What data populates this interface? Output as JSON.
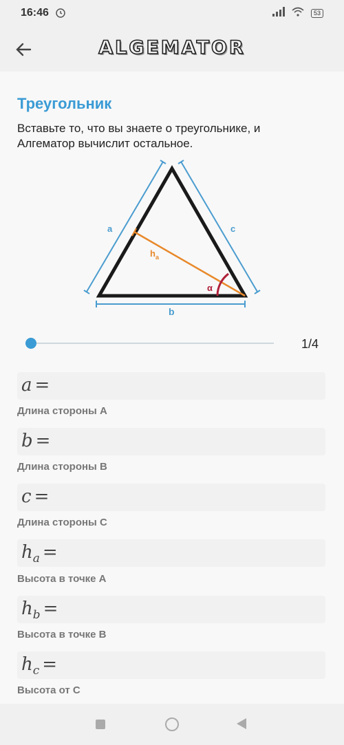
{
  "status_bar": {
    "time": "16:46",
    "battery": "53"
  },
  "app": {
    "logo": "ALGEMATOR"
  },
  "page": {
    "title": "Треугольник",
    "description": "Вставьте то, что вы знаете о треугольнике, и Алгематор вычислит остальное."
  },
  "diagram": {
    "side_a": "a",
    "side_b": "b",
    "side_c": "c",
    "height": "h",
    "height_sub": "a",
    "angle": "α"
  },
  "slider": {
    "label": "1/4",
    "progress": 0.0
  },
  "fields": [
    {
      "symbol": "a",
      "sub": "",
      "eq": "=",
      "value": "",
      "caption": "Длина стороны A"
    },
    {
      "symbol": "b",
      "sub": "",
      "eq": "=",
      "value": "",
      "caption": "Длина стороны B"
    },
    {
      "symbol": "c",
      "sub": "",
      "eq": "=",
      "value": "",
      "caption": "Длина стороны C"
    },
    {
      "symbol": "h",
      "sub": "a",
      "eq": "=",
      "value": "",
      "caption": "Высота в точке A"
    },
    {
      "symbol": "h",
      "sub": "b",
      "eq": "=",
      "value": "",
      "caption": "Высота в точке B"
    },
    {
      "symbol": "h",
      "sub": "c",
      "eq": "=",
      "value": "",
      "caption": "Высота от C"
    }
  ],
  "colors": {
    "accent": "#3a9bd5",
    "height_line": "#e8892b",
    "angle": "#b0203a"
  }
}
